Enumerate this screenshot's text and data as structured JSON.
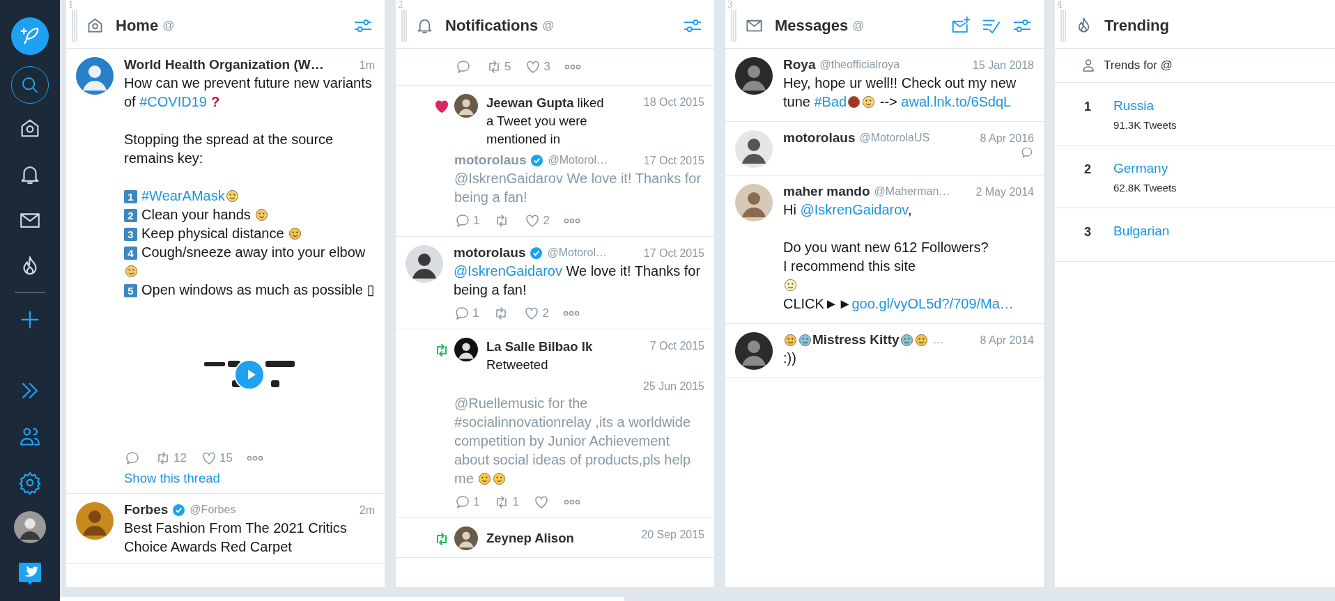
{
  "columns": [
    {
      "number": "1",
      "kind": "home",
      "title": "Home",
      "handle": "@",
      "items": [
        {
          "kind": "tweet",
          "name": "World Health Organization (W…",
          "verified": false,
          "time": "1m",
          "body": [
            {
              "kind": "text",
              "text": "How can we prevent future new variants of "
            },
            {
              "kind": "link",
              "text": "#COVID19"
            },
            {
              "kind": "mark",
              "text": "?",
              "color": "#be1931"
            },
            {
              "kind": "text",
              "text": "\n\nStopping the spread at the source remains key:\n\n"
            },
            {
              "kind": "keycap",
              "text": "1"
            },
            {
              "kind": "link",
              "text": "#WearAMask"
            },
            {
              "kind": "emoji",
              "color": "#f7d26a"
            },
            {
              "kind": "break"
            },
            {
              "kind": "keycap",
              "text": "2"
            },
            {
              "kind": "text",
              "text": "Clean your hands "
            },
            {
              "kind": "emoji",
              "color": "#f5c96b"
            },
            {
              "kind": "break"
            },
            {
              "kind": "keycap",
              "text": "3"
            },
            {
              "kind": "text",
              "text": "Keep physical distance "
            },
            {
              "kind": "emoji",
              "color": "#f2c14e"
            },
            {
              "kind": "break"
            },
            {
              "kind": "keycap",
              "text": "4"
            },
            {
              "kind": "text",
              "text": "Cough/sneeze away into your elbow "
            },
            {
              "kind": "emoji",
              "color": "#f5c96b"
            },
            {
              "kind": "break"
            },
            {
              "kind": "keycap",
              "text": "5"
            },
            {
              "kind": "text",
              "text": "Open windows as much as possible ▯"
            }
          ],
          "media": {
            "kind": "video"
          },
          "actions": {
            "retweets": "12",
            "likes": "15"
          },
          "thread_link": "Show this thread"
        },
        {
          "kind": "tweet",
          "name": "Forbes",
          "verified": true,
          "handle": "@Forbes",
          "time": "2m",
          "body": [
            {
              "kind": "text",
              "text": "Best Fashion From The 2021 Critics Choice Awards Red Carpet"
            }
          ]
        }
      ]
    },
    {
      "number": "2",
      "kind": "notifications",
      "title": "Notifications",
      "handle": "@",
      "items": [
        {
          "kind": "actions",
          "actions": {
            "retweets": "5",
            "likes": "3"
          }
        },
        {
          "kind": "like",
          "sentence": "**Jeewan Gupta** liked\na Tweet you were\nmentioned in",
          "time": "18 Oct 2015",
          "quoted": {
            "name": "motorolaus",
            "verified": true,
            "handle": "@Motorol…",
            "time": "17 Oct 2015",
            "body": [
              {
                "kind": "text",
                "text": "@IskrenGaidarov We love it! Thanks for being a fan!"
              }
            ]
          },
          "actions": {
            "replies": "1",
            "likes": "2"
          }
        },
        {
          "kind": "tweet",
          "name": "motorolaus",
          "verified": true,
          "handle": "@Motorol…",
          "time": "17 Oct 2015",
          "body": [
            {
              "kind": "link",
              "text": "@IskrenGaidarov"
            },
            {
              "kind": "text",
              "text": " We love it! Thanks for being a fan!"
            }
          ],
          "actions": {
            "replies": "1",
            "likes": "2"
          }
        },
        {
          "kind": "retweet",
          "sentence": "**La Salle Bilbao Ik**\nRetweeted",
          "time": "7 Oct 2015",
          "quoted": {
            "time": "25 Jun 2015",
            "body": [
              {
                "kind": "text",
                "text": "@Ruellemusic for the #socialinnovationrelay ,its a worldwide competition by Junior Achievement about social ideas of products,pls help me "
              },
              {
                "kind": "emoji",
                "color": "#f7c948"
              },
              {
                "kind": "emoji",
                "color": "#f9cf4f"
              }
            ]
          },
          "actions": {
            "replies": "1",
            "retweets": "1"
          }
        },
        {
          "kind": "retweet",
          "sentence": "**Zeynep Alison**",
          "time": "20 Sep 2015"
        }
      ]
    },
    {
      "number": "3",
      "kind": "messages",
      "title": "Messages",
      "handle": "@",
      "items": [
        {
          "kind": "message",
          "name": "Roya",
          "handle": "@theofficialroya",
          "time": "15 Jan 2018",
          "replied": false,
          "body": [
            {
              "kind": "text",
              "text": "Hey, hope ur well!! Check out my new tune "
            },
            {
              "kind": "link",
              "text": "#Bad"
            },
            {
              "kind": "emoji",
              "color": "#b0302a"
            },
            {
              "kind": "emoji",
              "color": "#f5d76e"
            },
            {
              "kind": "text",
              "text": " --> "
            },
            {
              "kind": "link",
              "text": "awal.lnk.to/6SdqL"
            }
          ]
        },
        {
          "kind": "message",
          "name": "motorolaus",
          "handle": "@MotorolaUS",
          "time": "8 Apr 2016",
          "replied": true
        },
        {
          "kind": "message",
          "name": "maher mando",
          "handle": "@Maherman…",
          "time": "2 May 2014",
          "replied": false,
          "body": [
            {
              "kind": "text",
              "text": "Hi "
            },
            {
              "kind": "link",
              "text": "@IskrenGaidarov"
            },
            {
              "kind": "text",
              "text": ",\n\nDo you want new 612 Followers?\nI recommend this site\n"
            },
            {
              "kind": "emoji",
              "color": "#fff3c4"
            },
            {
              "kind": "text",
              "text": "\nCLICK►►"
            },
            {
              "kind": "link",
              "text": "goo.gl/vyOL5d?/709/Ma…"
            }
          ]
        },
        {
          "kind": "message",
          "name": [
            {
              "kind": "emoji",
              "color": "#f2c14e"
            },
            {
              "kind": "emoji",
              "color": "#7ec8e3"
            },
            {
              "kind": "text",
              "text": "Mistress Kitty "
            },
            {
              "kind": "emoji",
              "color": "#7ec8e3"
            },
            {
              "kind": "emoji",
              "color": "#f2c14e"
            }
          ],
          "handle": "…",
          "time": "8 Apr 2014",
          "replied": false,
          "body": [
            {
              "kind": "text",
              "text": ":))"
            }
          ]
        }
      ]
    },
    {
      "number": "4",
      "kind": "trending",
      "title": "Trending",
      "subtitle": "Trends for @",
      "trends": [
        {
          "rank": "1",
          "name": "Russia",
          "count": "91.3K Tweets"
        },
        {
          "rank": "2",
          "name": "Germany",
          "count": "62.8K Tweets"
        },
        {
          "rank": "3",
          "name": "Bulgarian"
        }
      ]
    }
  ]
}
